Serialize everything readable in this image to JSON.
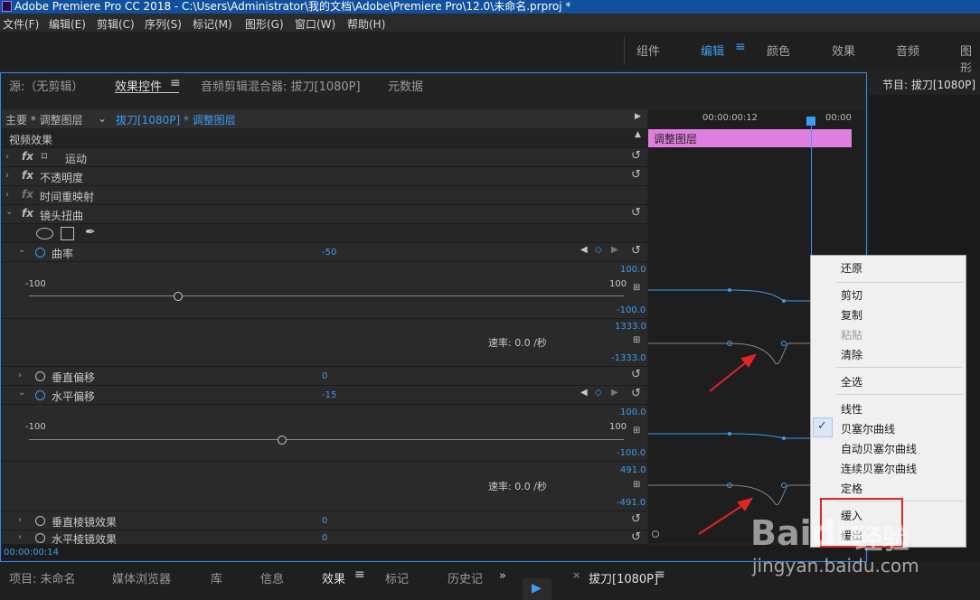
{
  "window": {
    "title": "Adobe Premiere Pro CC 2018 - C:\\Users\\Administrator\\我的文档\\Adobe\\Premiere Pro\\12.0\\未命名.prproj *"
  },
  "menu": [
    "文件(F)",
    "编辑(E)",
    "剪辑(C)",
    "序列(S)",
    "标记(M)",
    "图形(G)",
    "窗口(W)",
    "帮助(H)"
  ],
  "workspaces": {
    "items": [
      "组件",
      "编辑",
      "颜色",
      "效果",
      "音频",
      "图形"
    ],
    "active": "编辑"
  },
  "panel_tabs": {
    "source": "源:（无剪辑）",
    "effect_controls": "效果控件",
    "audio_mixer": "音频剪辑混合器: 拔刀[1080P]",
    "metadata": "元数据"
  },
  "program_monitor": {
    "title": "节目: 拔刀[1080P]"
  },
  "clip_header": {
    "master": "主要 * 调整图层",
    "clip": "拔刀[1080P] * 调整图层"
  },
  "timeline": {
    "timecode": "00:00:00:12",
    "timecode2": "00:00",
    "clip_label": "调整图层",
    "playhead_percent": 75
  },
  "effects": {
    "section": "视频效果",
    "motion": "运动",
    "opacity": "不透明度",
    "time_remap": "时间重映射",
    "lens": "镜头扭曲",
    "curvature": {
      "label": "曲率",
      "value": "-50",
      "min": "-100",
      "max": "100",
      "slider_fraction": 0.25,
      "graph_top": "100.0",
      "graph_bottom": "-100.0",
      "vel_top": "1333.0",
      "vel_bottom": "-1333.0",
      "speed": "速率: 0.0 /秒"
    },
    "vertical_offset": {
      "label": "垂直偏移",
      "value": "0"
    },
    "horizontal_offset": {
      "label": "水平偏移",
      "value": "-15",
      "min": "-100",
      "max": "100",
      "slider_fraction": 0.425,
      "graph_top": "100.0",
      "graph_bottom": "-100.0",
      "vel_top": "491.0",
      "vel_bottom": "-491.0",
      "speed": "速率: 0.0 /秒"
    },
    "vertical_prism": {
      "label": "垂直棱镜效果",
      "value": "0"
    },
    "horizontal_prism": {
      "label": "水平棱镜效果",
      "value": "0"
    }
  },
  "status_time": "00:00:00:14",
  "context_menu": {
    "items": [
      {
        "label": "还原",
        "disabled": false
      },
      {
        "label": "剪切",
        "disabled": false
      },
      {
        "label": "复制",
        "disabled": false
      },
      {
        "label": "粘贴",
        "disabled": true
      },
      {
        "label": "清除",
        "disabled": false
      },
      {
        "label": "全选",
        "disabled": false
      },
      {
        "label": "线性",
        "disabled": false
      },
      {
        "label": "贝塞尔曲线",
        "disabled": false,
        "checked": true
      },
      {
        "label": "自动贝塞尔曲线",
        "disabled": false
      },
      {
        "label": "连续贝塞尔曲线",
        "disabled": false
      },
      {
        "label": "定格",
        "disabled": false
      },
      {
        "label": "缓入",
        "disabled": false
      },
      {
        "label": "缓出",
        "disabled": false
      }
    ]
  },
  "bottom_tabs": [
    "项目: 未命名",
    "媒体浏览器",
    "库",
    "信息",
    "效果",
    "标记",
    "历史记"
  ],
  "bottom_right": {
    "sequence_tab": "拔刀[1080P]"
  },
  "watermark": {
    "brand": "Baidu",
    "cn": "经验",
    "url": "jingyan.baidu.com"
  },
  "colors": {
    "accent": "#3d9cf0",
    "clip": "#e07ee0",
    "annotation": "#e02525"
  }
}
